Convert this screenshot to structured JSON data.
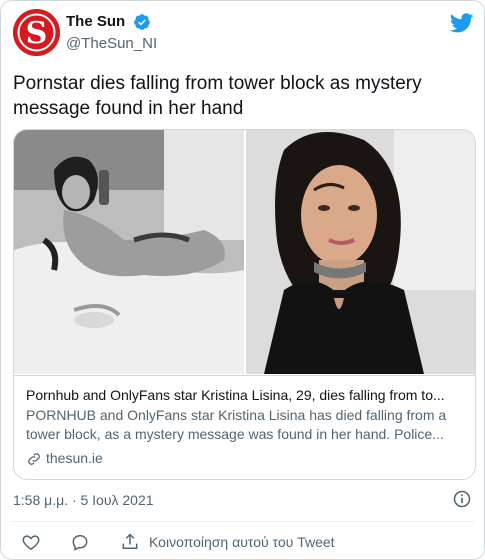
{
  "account": {
    "display_name": "The Sun",
    "handle": "@TheSun_NI",
    "verified": true
  },
  "tweet": {
    "text": "Pornstar dies falling from tower block as mystery message found in her hand",
    "timestamp": "1:58 μ.μ. · 5 Ιουλ 2021"
  },
  "card": {
    "title": "Pornhub and OnlyFans star Kristina Lisina, 29, dies falling from to...",
    "description_line1": "PORNHUB and OnlyFans star Kristina Lisina has died falling from a",
    "description_line2": "tower block, as a mystery message was found in her hand. Police...",
    "domain": "thesun.ie",
    "images": [
      "photo-left-bw",
      "photo-right-selfie"
    ]
  },
  "actions": {
    "share_label": "Κοινοποίηση αυτού του Tweet"
  },
  "colors": {
    "brand_red": "#d71920",
    "twitter_blue": "#1d9bf0",
    "secondary_text": "#536471",
    "border": "#cfd9de"
  },
  "icons": [
    "avatar-logo",
    "verified-badge-icon",
    "twitter-bird-icon",
    "link-icon",
    "info-icon",
    "heart-icon",
    "reply-icon",
    "share-icon"
  ]
}
